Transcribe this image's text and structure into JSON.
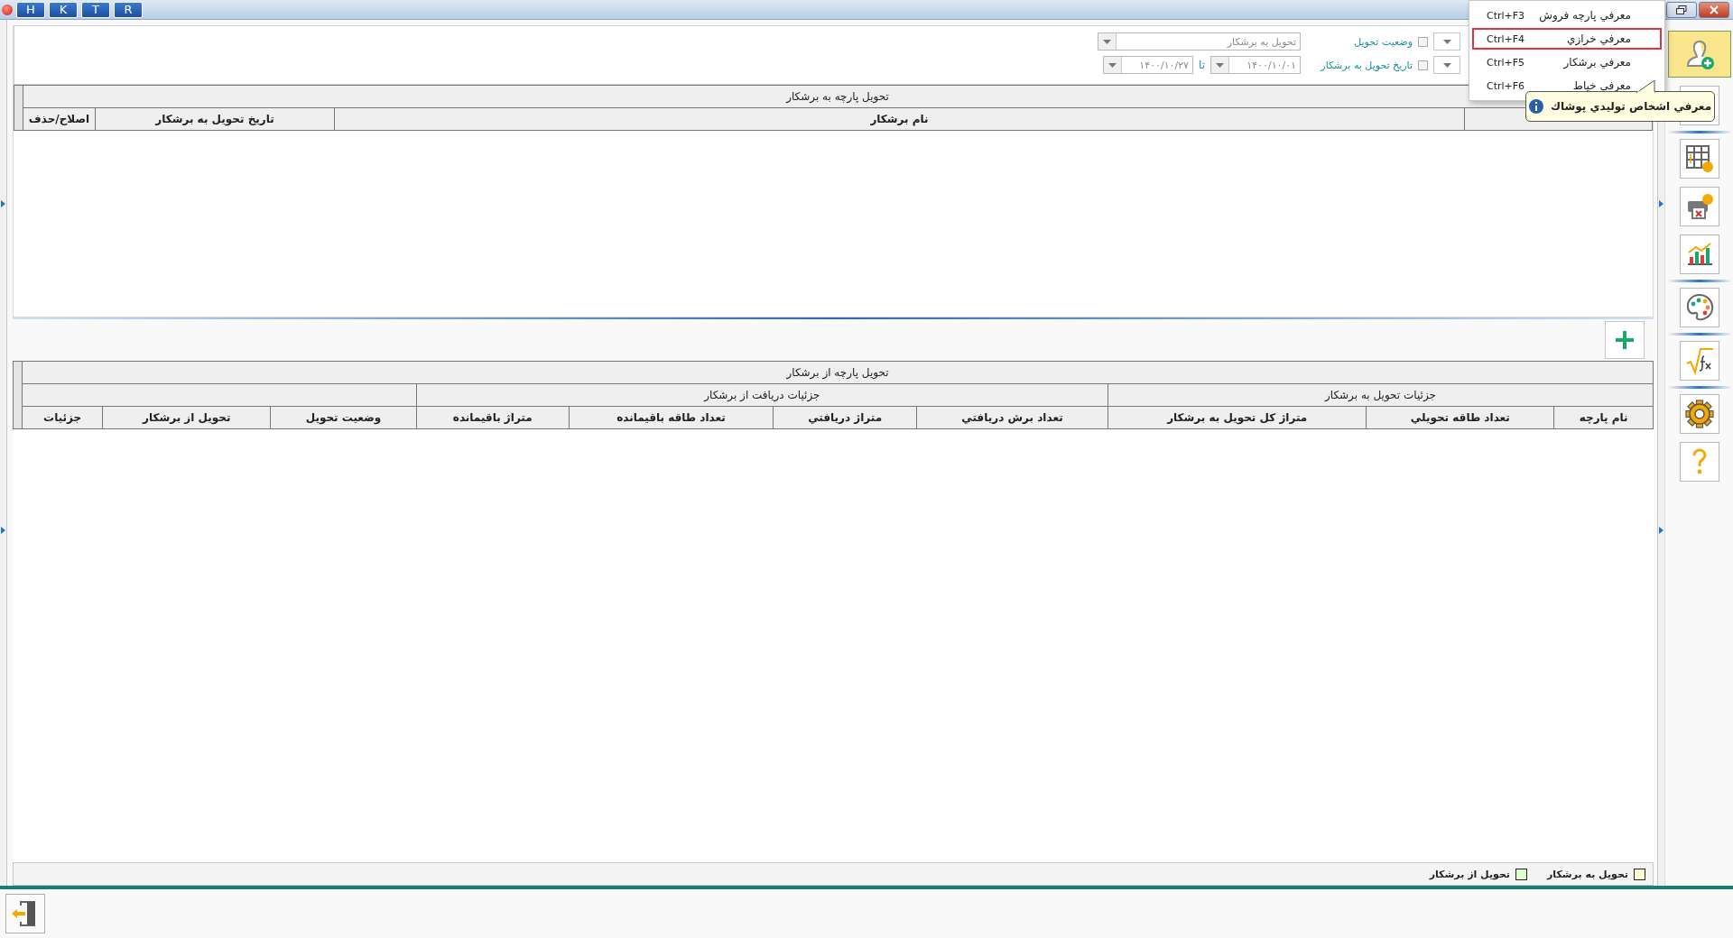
{
  "title_bar": {
    "buttons": [
      "R",
      "T",
      "K",
      "H"
    ]
  },
  "filters": {
    "status": {
      "label": "وضعیت تحویل",
      "checked": false,
      "value": "تحویل به برشکار",
      "disabled": true
    },
    "date": {
      "label": "تاریخ تحویل به برشکار",
      "checked": false,
      "from": "۱۴۰۰/۱۰/۰۱",
      "to_label": "تا",
      "to": "۱۴۰۰/۱۰/۲۷",
      "disabled": true
    }
  },
  "table_1": {
    "title": "تحویل پارچه به برشکار",
    "columns": [
      "نام برشکار",
      "تاریخ تحویل به برشکار",
      "اصلاح/حذف"
    ]
  },
  "table_2": {
    "title": "تحویل پارچه از برشکار",
    "groups": [
      {
        "label": "جزئیات تحویل به برشکار",
        "columns": [
          "نام پارچه",
          "تعداد طاقه تحویلي",
          "متراژ کل تحویل به برشکار"
        ]
      },
      {
        "label": "جزئیات دریافت از برشکار",
        "columns": [
          "تعداد برش دریافتي",
          "متراژ دریافتي",
          "تعداد طاقه باقیمانده",
          "متراژ باقیمانده"
        ]
      },
      {
        "columns": [
          "وضعیت تحویل",
          "تحویل از برشکار",
          "جزئیات"
        ]
      }
    ]
  },
  "legend": [
    {
      "label": "تحویل به برشکار",
      "color": "#ffffd0"
    },
    {
      "label": "تحویل از برشکار",
      "color": "#e0ffd0"
    }
  ],
  "menu": {
    "items": [
      {
        "label": "معرفي پارچه فروش",
        "shortcut": "Ctrl+F3",
        "selected": false
      },
      {
        "label": "معرفي خرازي",
        "shortcut": "Ctrl+F4",
        "selected": true
      },
      {
        "label": "معرفي برشکار",
        "shortcut": "Ctrl+F5",
        "selected": false
      },
      {
        "label": "معرفي خياط",
        "shortcut": "Ctrl+F6",
        "selected": false
      }
    ]
  },
  "tooltip": {
    "text": "معرفي اشخاص توليدي پوشاك"
  },
  "sidebar": {
    "groups": [
      {
        "items": [
          {
            "kind": "person-add",
            "selected": true
          },
          {
            "kind": "blank",
            "selected": false
          }
        ]
      },
      {
        "items": [
          {
            "kind": "sheet",
            "selected": false
          },
          {
            "kind": "printer",
            "selected": false
          },
          {
            "kind": "chart",
            "selected": false
          }
        ]
      },
      {
        "items": [
          {
            "kind": "palette",
            "selected": false
          }
        ]
      },
      {
        "items": [
          {
            "kind": "formula",
            "selected": false
          }
        ]
      },
      {
        "items": [
          {
            "kind": "gear",
            "selected": false
          },
          {
            "kind": "help",
            "selected": false
          }
        ]
      }
    ]
  }
}
